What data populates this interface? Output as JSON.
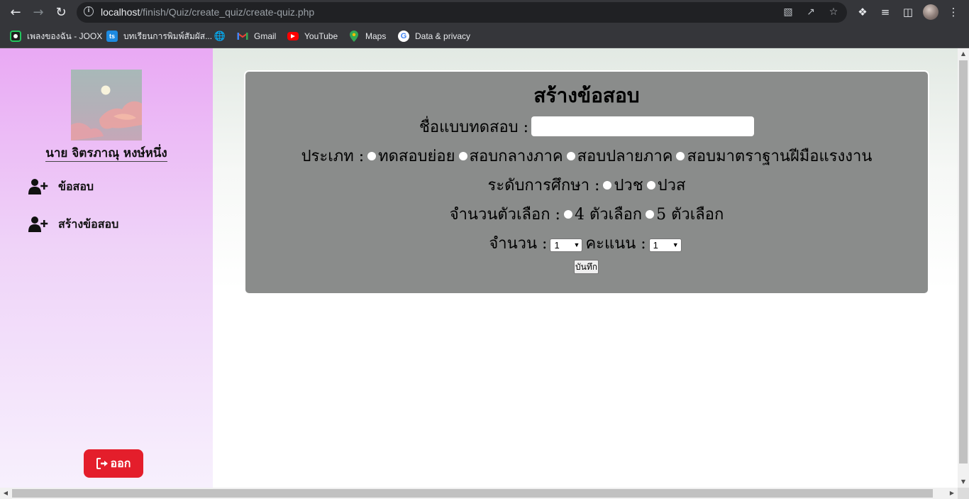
{
  "browser": {
    "url_host": "localhost",
    "url_path": "/finish/Quiz/create_quiz/create-quiz.php",
    "bookmarks": [
      {
        "label": "เพลงของฉัน - JOOX",
        "icon": "joox-icon"
      },
      {
        "label": "บทเรียนการพิมพ์สัมผัส...",
        "icon": "ts-icon"
      },
      {
        "label": "",
        "icon": "globe-icon"
      },
      {
        "label": "Gmail",
        "icon": "gmail-icon"
      },
      {
        "label": "YouTube",
        "icon": "youtube-icon"
      },
      {
        "label": "Maps",
        "icon": "maps-icon"
      },
      {
        "label": "Data & privacy",
        "icon": "google-icon"
      }
    ]
  },
  "sidebar": {
    "user_name": "นาย จิตรภาณุ หงษ์หนึ่ง",
    "menu": [
      {
        "label": "ข้อสอบ",
        "icon": "user-plus-icon"
      },
      {
        "label": "สร้างข้อสอบ",
        "icon": "user-plus-icon"
      }
    ],
    "logout_label": "ออก"
  },
  "form": {
    "title": "สร้างข้อสอบ",
    "name_label": "ชื่อแบบทดสอบ :",
    "name_value": "",
    "type_label": "ประเภท :",
    "type_options": [
      "ทดสอบย่อย",
      "สอบกลางภาค",
      "สอบปลายภาค",
      "สอบมาตราฐานฝีมือแรงงาน"
    ],
    "level_label": "ระดับการศึกษา :",
    "level_options": [
      "ปวช",
      "ปวส"
    ],
    "choices_label": "จำนวนตัวเลือก :",
    "choices_options": [
      "4 ตัวเลือก",
      "5 ตัวเลือก"
    ],
    "count_label": "จำนวน :",
    "count_value": "1",
    "score_label": "คะแนน :",
    "score_value": "1",
    "save_label": "บันทึก"
  },
  "colors": {
    "sidebar_top": "#e9a9f4",
    "card_bg": "#8a8c8b",
    "logout_bg": "#e41e2b"
  }
}
